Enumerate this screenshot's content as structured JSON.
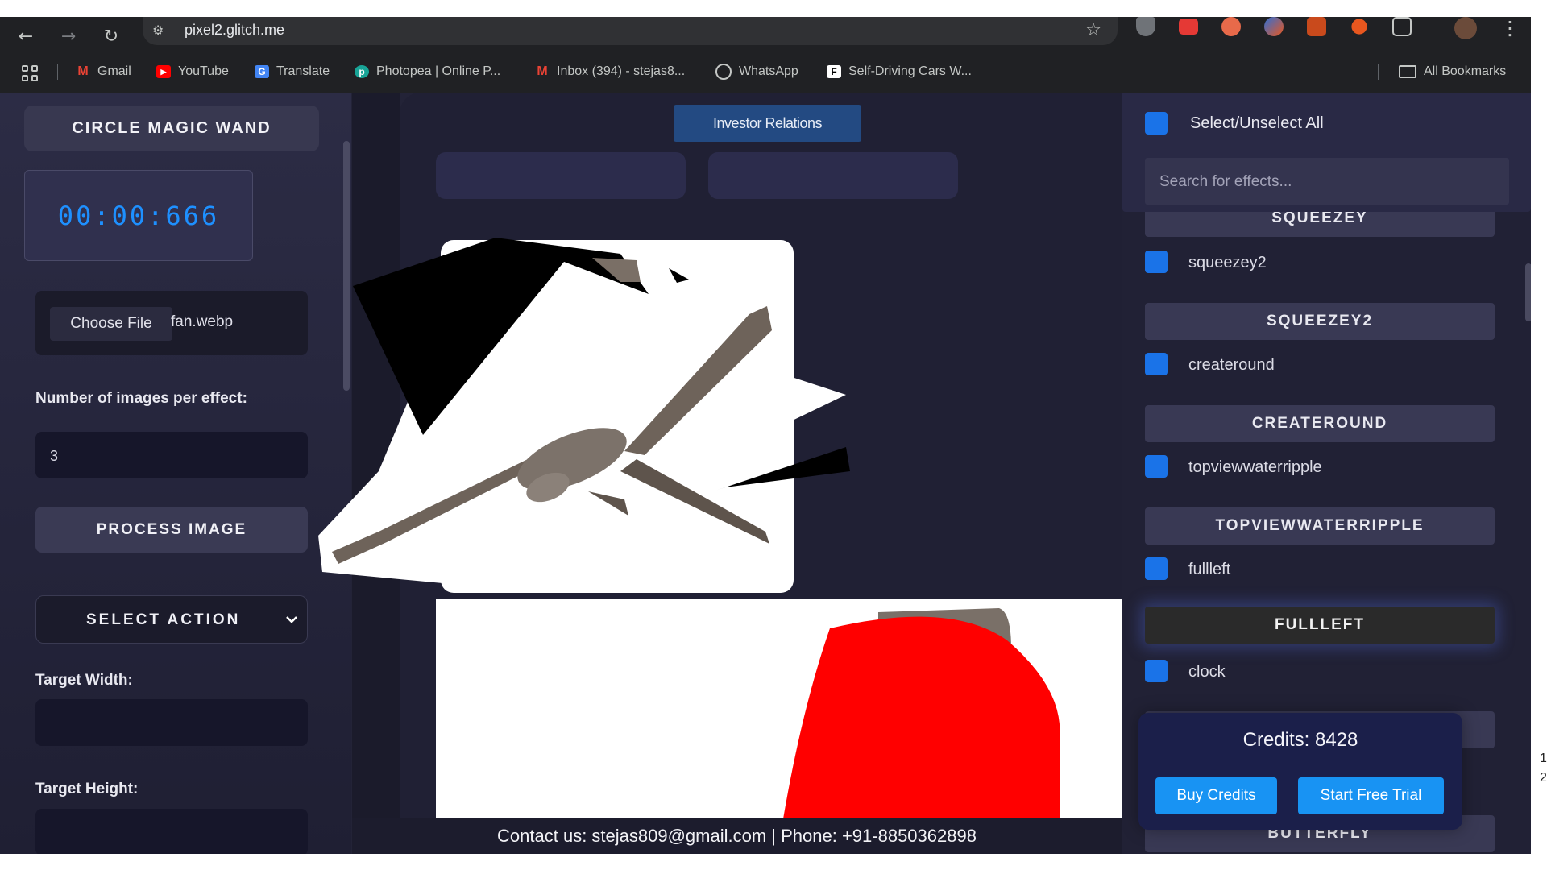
{
  "browser": {
    "url": "pixel2.glitch.me",
    "icons": {
      "back": "arrow-left-icon",
      "forward": "arrow-right-icon",
      "reload": "reload-icon",
      "site_info": "tune-icon",
      "bookmark": "star-icon",
      "menu": "kebab-menu-icon"
    },
    "bookmarks": [
      {
        "label": "Gmail",
        "icon": "gmail-icon",
        "color": "#ea4335"
      },
      {
        "label": "YouTube",
        "icon": "youtube-icon",
        "color": "#ff0000"
      },
      {
        "label": "Translate",
        "icon": "translate-icon",
        "color": "#4285f4"
      },
      {
        "label": "Photopea | Online P...",
        "icon": "photopea-icon",
        "color": "#18a497"
      },
      {
        "label": "Inbox (394) - stejas8...",
        "icon": "gmail-icon",
        "color": "#ea4335"
      },
      {
        "label": "WhatsApp",
        "icon": "whatsapp-icon",
        "color": "#25d366"
      },
      {
        "label": "Self-Driving Cars W...",
        "icon": "f-icon",
        "color": "#ffffff"
      }
    ],
    "all_bookmarks": "All Bookmarks"
  },
  "left_panel": {
    "title": "CIRCLE MAGIC WAND",
    "timer": "00:00:666",
    "choose_file": "Choose File",
    "file_name": "fan.webp",
    "images_label": "Number of images per effect:",
    "images_value": "3",
    "process_button": "PROCESS IMAGE",
    "select_action": "SELECT ACTION",
    "target_width_label": "Target Width:",
    "target_height_label": "Target Height:"
  },
  "center": {
    "top_button": "Investor Relations",
    "footer": "Contact us: stejas809@gmail.com | Phone: +91-8850362898"
  },
  "effects_panel": {
    "select_all": "Select/Unselect All",
    "search_placeholder": "Search for effects...",
    "clipped_head_top": "SQUEEZEY",
    "rows": [
      {
        "label": "squeezey2",
        "head": "SQUEEZEY2"
      },
      {
        "label": "createround",
        "head": "CREATEROUND"
      },
      {
        "label": "topviewwaterripple",
        "head": "TOPVIEWWATERRIPPLE"
      },
      {
        "label": "fullleft",
        "head": "FULLLEFT"
      },
      {
        "label": "clock",
        "head": ""
      }
    ],
    "clipped_head_bottom": "BUTTERFLY",
    "active_head": "FULLLEFT",
    "accent_color": "#1a73e8"
  },
  "credits": {
    "text": "Credits: 8428",
    "buy_button": "Buy Credits",
    "trial_button": "Start Free Trial"
  },
  "edge_digits": [
    "1",
    "2"
  ]
}
